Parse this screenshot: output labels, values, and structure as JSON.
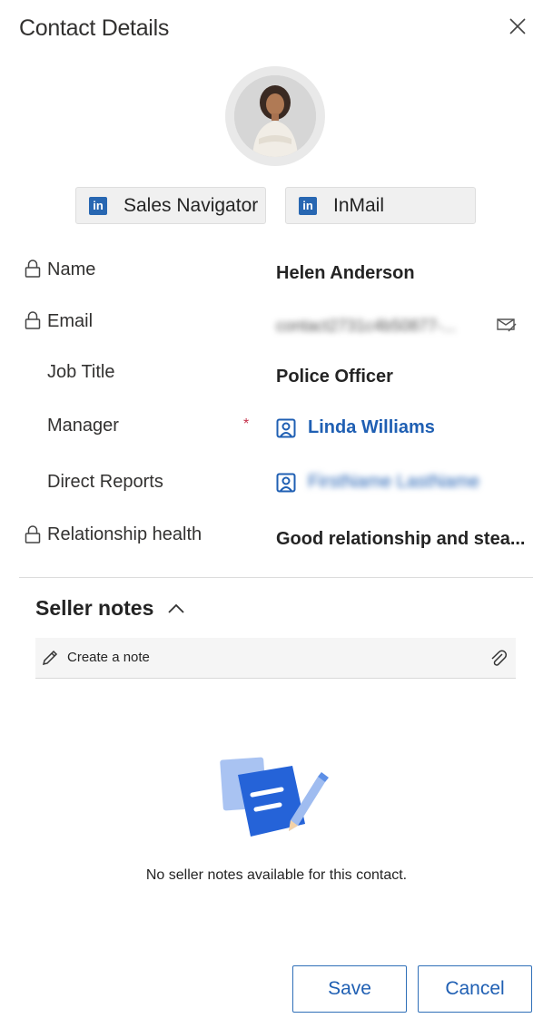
{
  "panel": {
    "title": "Contact Details"
  },
  "linkedin": {
    "sales_navigator_label": "Sales Navigator",
    "inmail_label": "InMail",
    "brand_color": "#2867b2",
    "icon_text": "in"
  },
  "fields": {
    "name": {
      "label": "Name",
      "value": "Helen Anderson"
    },
    "email": {
      "label": "Email",
      "value": "contact2731c4b50877-..."
    },
    "job_title": {
      "label": "Job Title",
      "value": "Police Officer"
    },
    "manager": {
      "label": "Manager",
      "required_mark": "*",
      "value": "Linda Williams"
    },
    "direct_reports": {
      "label": "Direct Reports",
      "value": "FirstName LastName"
    },
    "relationship_health": {
      "label": "Relationship health",
      "value": "Good relationship and stea..."
    }
  },
  "seller_notes": {
    "title": "Seller notes",
    "create_label": "Create a note",
    "empty_message": "No seller notes available for this contact."
  },
  "footer": {
    "save_label": "Save",
    "cancel_label": "Cancel"
  },
  "colors": {
    "link": "#1f5fb3",
    "required": "#c4314b",
    "accent": "#2f6fb8"
  }
}
